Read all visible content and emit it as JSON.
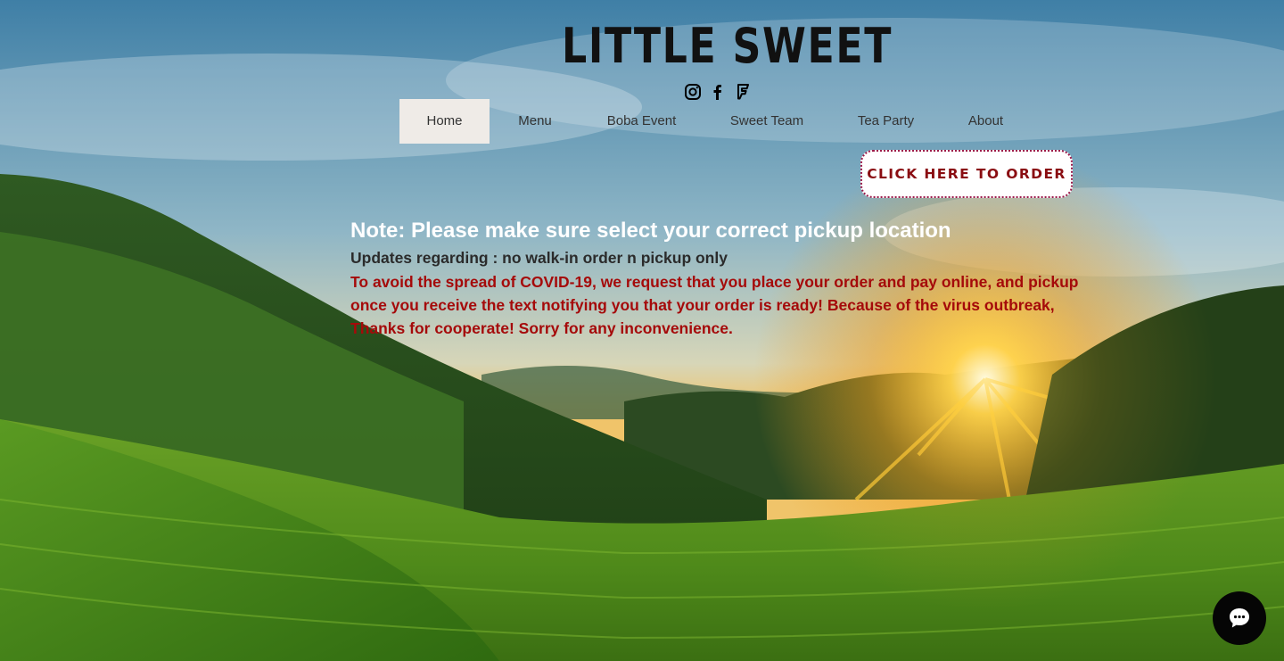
{
  "brand": {
    "name": "LITTLE SWEET"
  },
  "social": [
    {
      "icon": "instagram-icon"
    },
    {
      "icon": "facebook-icon"
    },
    {
      "icon": "foursquare-icon"
    }
  ],
  "nav": {
    "items": [
      {
        "label": "Home",
        "active": true
      },
      {
        "label": "Menu",
        "active": false
      },
      {
        "label": "Boba Event",
        "active": false
      },
      {
        "label": "Sweet Team",
        "active": false
      },
      {
        "label": "Tea Party",
        "active": false
      },
      {
        "label": "About",
        "active": false
      }
    ]
  },
  "order_button": {
    "label": "CLICK HERE TO ORDER"
  },
  "notice": {
    "title": "Note: Please make sure select your correct pickup location",
    "update": "Updates regarding : no walk-in order n pickup only",
    "body": "To avoid the spread of COVID-19, we request that you place your order and pay online, and pickup once you receive the text notifying you that your order is ready! Because of the virus outbreak, Thanks for cooperate! Sorry for any inconvenience."
  },
  "chat": {
    "icon": "chat-bubble-icon"
  },
  "colors": {
    "nav_active_bg": "#efebe7",
    "order_text": "#8a0d12",
    "order_border": "#9b1a4a",
    "notice_body": "#a50a0a",
    "chat_bg": "#050505"
  }
}
